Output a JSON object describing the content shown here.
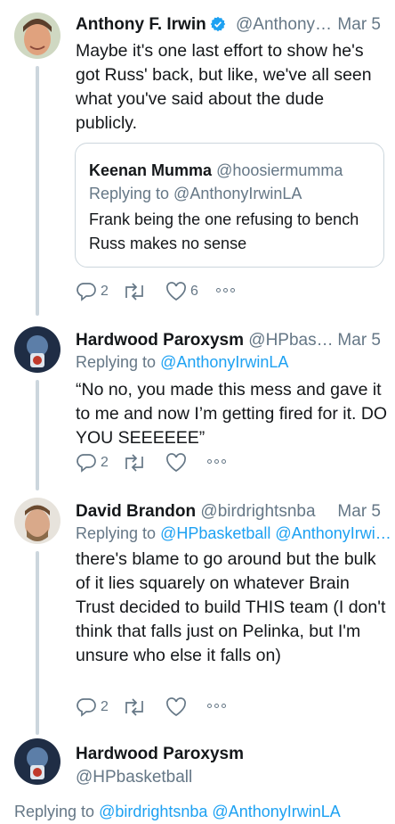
{
  "tweets": [
    {
      "name": "Anthony F. Irwin",
      "handle": "@Anthony…",
      "date": "Mar 5",
      "verified": true,
      "body": "Maybe it's one last effort to show he's got Russ' back, but like, we've all seen what you've said about the dude publicly.",
      "quote": {
        "name": "Keenan Mumma",
        "handle": "@hoosiermumma",
        "replying": "Replying to @AnthonyIrwinLA",
        "body": "Frank being the one refusing to bench Russ makes no sense"
      },
      "replies": "2",
      "retweets": "",
      "likes": "6"
    },
    {
      "name": "Hardwood Paroxysm",
      "handle": "@HPbas…",
      "date": "Mar 5",
      "replying_prefix": "Replying to",
      "replying_to": "@AnthonyIrwinLA",
      "body": "“No no, you made this mess and gave it to me and now I’m getting fired for it. DO YOU SEEEEEE”",
      "replies": "2",
      "retweets": "",
      "likes": ""
    },
    {
      "name": "David Brandon",
      "handle": "@birdrightsnba",
      "date": "Mar 5",
      "replying_prefix": "Replying to",
      "replying_to": "@HPbasketball @AnthonyIrwi…",
      "body": "there's blame to go around but the bulk of it lies squarely on whatever Brain Trust decided to build THIS team (I don't think that falls just on Pelinka, but I'm unsure who else it falls on)",
      "replies": "2",
      "retweets": "",
      "likes": ""
    },
    {
      "name": "Hardwood Paroxysm",
      "handle": "@HPbasketball",
      "replying_prefix": "Replying to",
      "replying_to": "@birdrightsnba @AnthonyIrwinLA"
    }
  ],
  "colors": {
    "accent": "#1da1f2",
    "muted": "#657786",
    "text": "#14171a",
    "border": "#ccd6dd"
  },
  "icons": [
    "verified-icon",
    "reply-icon",
    "retweet-icon",
    "like-icon",
    "more-icon"
  ]
}
